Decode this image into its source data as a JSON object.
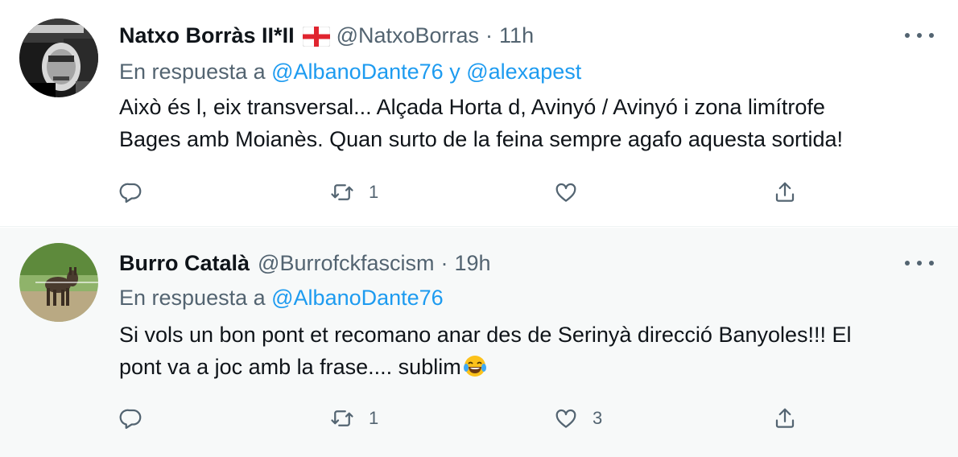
{
  "tweets": [
    {
      "name": "Natxo Borràs II*II",
      "flag_icon": "england-flag-icon",
      "handle": "@NatxoBorras",
      "separator": "·",
      "time": "11h",
      "replying_prefix": "En respuesta a",
      "mention_1": "@AlbanoDante76",
      "conjunction": "y",
      "mention_2": "@alexapest",
      "text_line_1": "Això és l, eix transversal... Alçada Horta d, Avinyó / Avinyó i zona limítrofe",
      "text_line_2": "Bages amb Moianès. Quan surto de la feina sempre agafo aquesta sortida!",
      "retweets": "1",
      "likes": ""
    },
    {
      "name": "Burro Català",
      "handle": "@Burrofckfascism",
      "separator": "·",
      "time": "19h",
      "replying_prefix": "En respuesta a",
      "mention_1": "@AlbanoDante76",
      "text_line_1": "Si vols un bon pont et recomano anar des de Serinyà direcció Banyoles!!! El",
      "text_line_2": "pont va a joc amb la frase.... sublim",
      "emoji_icon": "tears-of-joy-emoji-icon",
      "retweets": "1",
      "likes": "3"
    }
  ],
  "colors": {
    "text": "#0f1419",
    "secondary": "#536471",
    "link": "#1d9bf0",
    "highlight_bg": "#f7f9f9",
    "divider": "#eff3f4"
  }
}
